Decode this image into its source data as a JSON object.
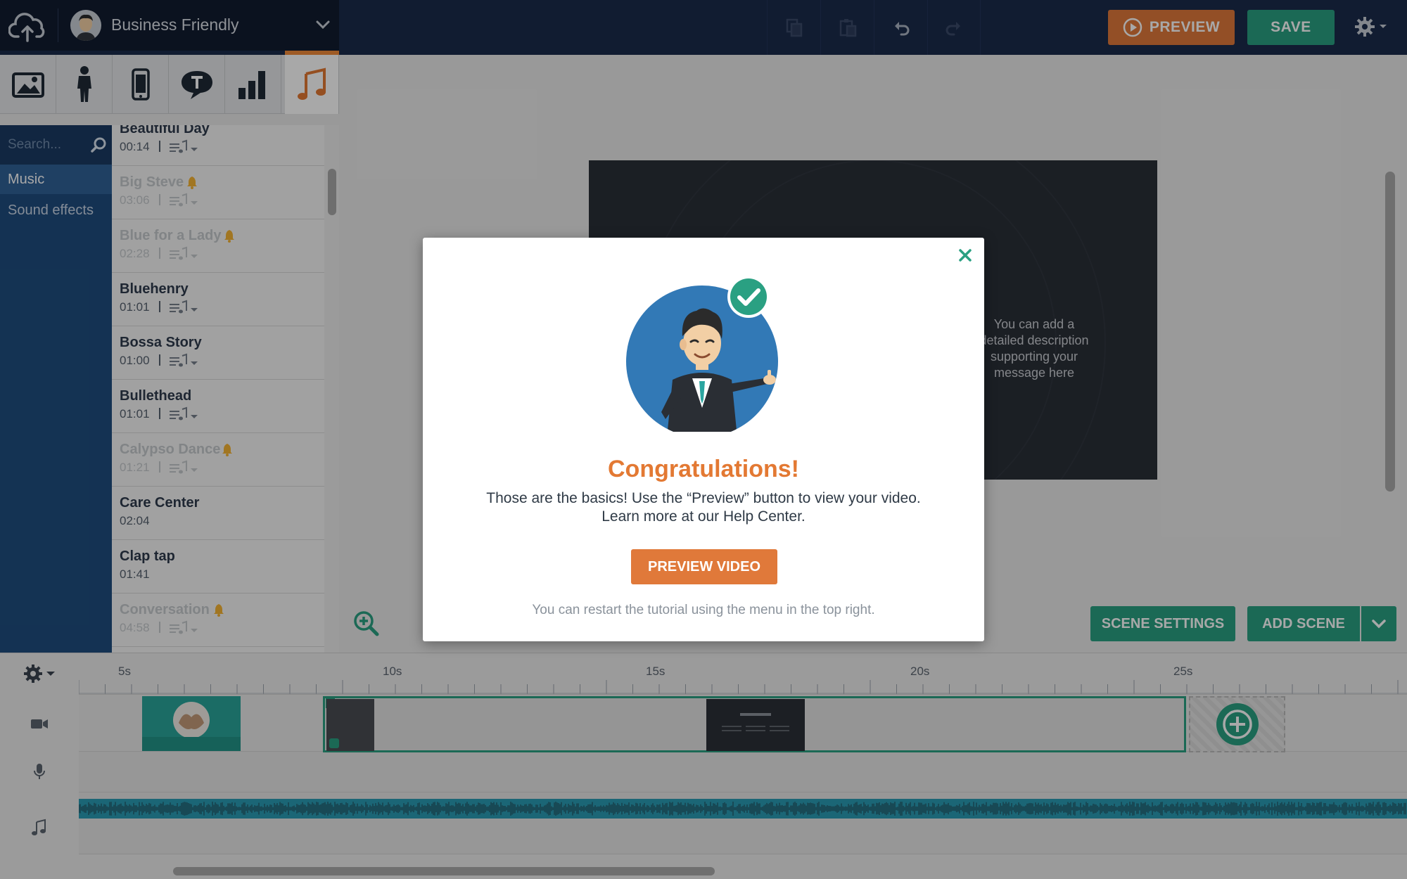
{
  "topbar": {
    "theme_name": "Business Friendly",
    "preview_label": "PREVIEW",
    "save_label": "SAVE",
    "icons": [
      "upload-cloud-icon",
      "copy-icon",
      "paste-icon",
      "undo-icon",
      "redo-icon",
      "gear-icon"
    ]
  },
  "asset_tabs": [
    "image-icon",
    "character-icon",
    "device-icon",
    "text-bubble-icon",
    "chart-icon",
    "music-note-icon"
  ],
  "sidebar": {
    "search_placeholder": "Search...",
    "categories": [
      {
        "label": "Music",
        "active": true
      },
      {
        "label": "Sound effects",
        "active": false
      }
    ]
  },
  "music_list": {
    "tracks": [
      {
        "name": "Beautiful Day",
        "duration": "00:14",
        "available": true,
        "premium": false
      },
      {
        "name": "Big Steve",
        "duration": "03:06",
        "available": false,
        "premium": true
      },
      {
        "name": "Blue for a Lady",
        "duration": "02:28",
        "available": false,
        "premium": true
      },
      {
        "name": "Bluehenry",
        "duration": "01:01",
        "available": true,
        "premium": false
      },
      {
        "name": "Bossa Story",
        "duration": "01:00",
        "available": true,
        "premium": false
      },
      {
        "name": "Bullethead",
        "duration": "01:01",
        "available": true,
        "premium": false
      },
      {
        "name": "Calypso Dance",
        "duration": "01:21",
        "available": false,
        "premium": true
      },
      {
        "name": "Care Center",
        "duration": "02:04",
        "available": true,
        "premium": false
      },
      {
        "name": "Clap tap",
        "duration": "01:41",
        "available": true,
        "premium": false
      },
      {
        "name": "Conversation",
        "duration": "04:58",
        "available": false,
        "premium": true
      }
    ]
  },
  "stage": {
    "scene_text": "You can add a detailed description supporting your message here",
    "scene_settings_label": "SCENE SETTINGS",
    "add_scene_label": "ADD SCENE"
  },
  "modal": {
    "title": "Congratulations!",
    "body_line1": "Those are the basics! Use the “Preview” button to view your video.",
    "body_line2": "Learn more at our Help Center.",
    "button_label": "PREVIEW VIDEO",
    "footnote": "You can restart the tutorial using the menu in the top right."
  },
  "timeline": {
    "ticks": [
      "5s",
      "10s",
      "15s",
      "20s",
      "25s"
    ],
    "scene_number": "3",
    "track_icons": [
      "video-camera-icon",
      "microphone-icon",
      "music-note-icon"
    ]
  },
  "colors": {
    "topbar": "#1b2b4b",
    "accent_orange": "#e0793a",
    "accent_green": "#2aa082",
    "sidebar": "#1f4d7e"
  }
}
